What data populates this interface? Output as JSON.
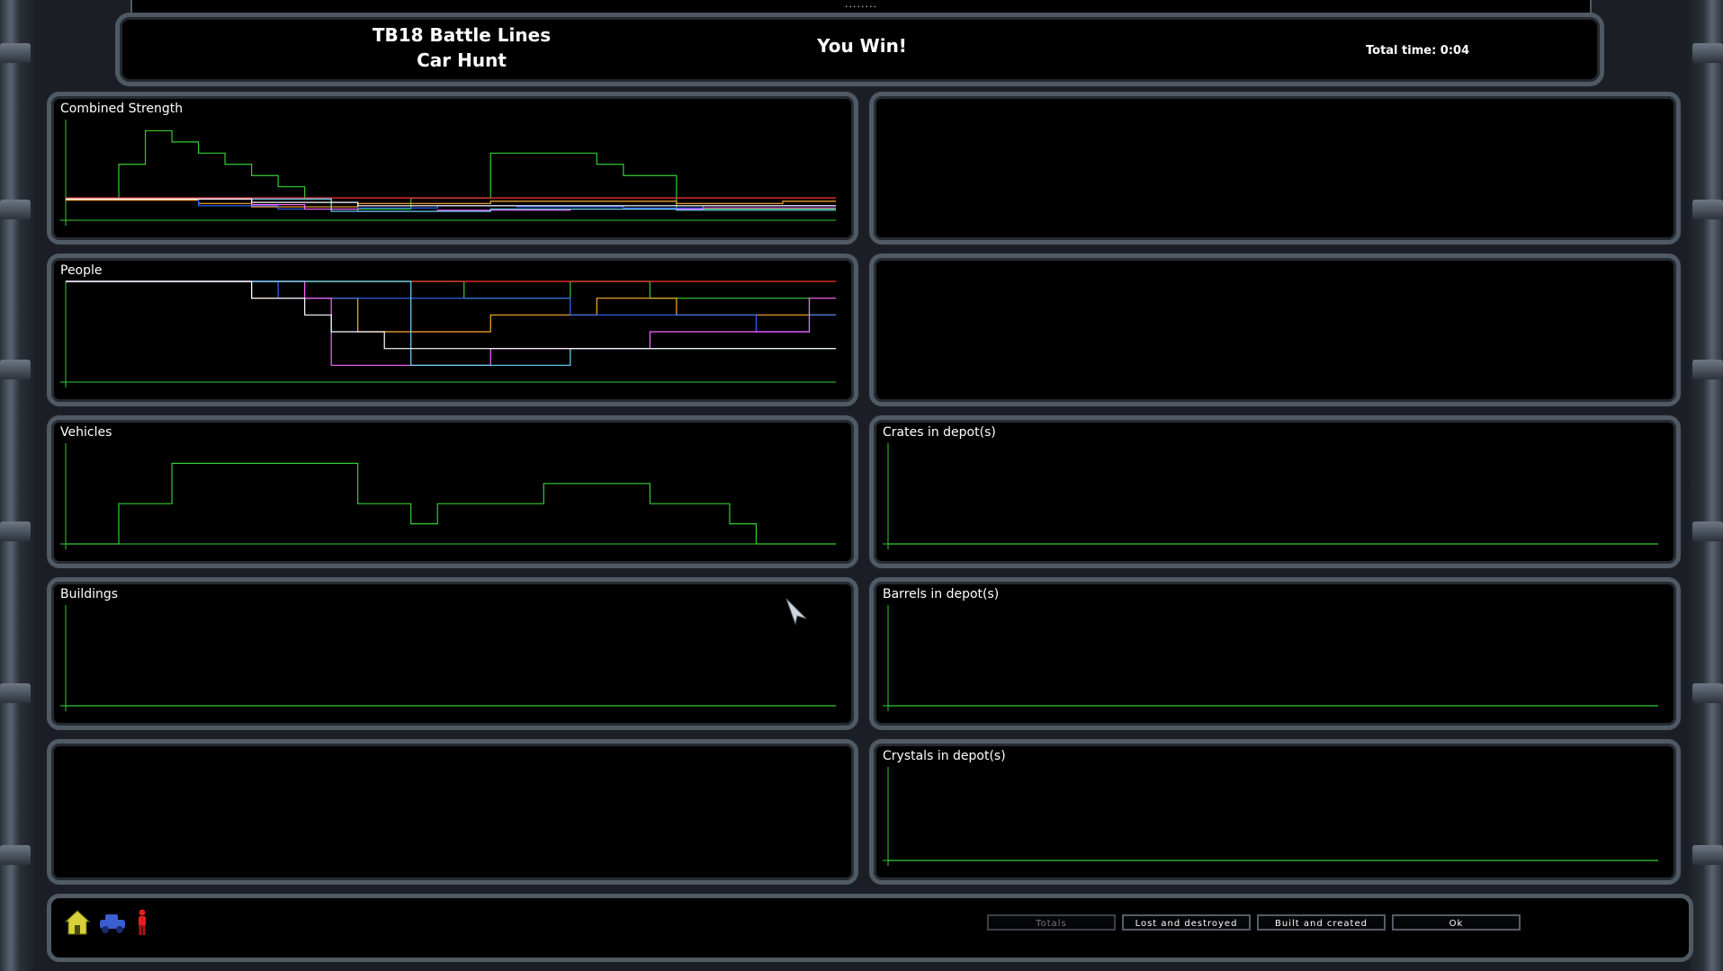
{
  "header": {
    "dots": "........",
    "title_line1": "TB18 Battle Lines",
    "title_line2": "Car Hunt",
    "result": "You Win!",
    "total_time": "Total time: 0:04"
  },
  "panels": {
    "combined_strength": "Combined Strength",
    "people": "People",
    "vehicles": "Vehicles",
    "buildings": "Buildings",
    "crates": "Crates in depot(s)",
    "barrels": "Barrels in depot(s)",
    "crystals": "Crystals in depot(s)"
  },
  "footer": {
    "buttons": [
      "Totals",
      "Lost and destroyed",
      "Built and created",
      "Ok"
    ],
    "icons": [
      "building-icon",
      "vehicle-icon",
      "person-icon"
    ]
  },
  "colors": {
    "green": "#33cc33",
    "red": "#ff3333",
    "orange": "#ffaa33",
    "blue": "#3366ff",
    "magenta": "#ff66ff",
    "cyan": "#66ddff",
    "white": "#ffffff",
    "panel_border": "#505a65"
  },
  "chart_data": [
    {
      "type": "line",
      "title": "Combined Strength",
      "x": [
        0,
        1,
        2,
        3,
        4,
        5,
        6,
        7,
        8,
        9,
        10,
        11,
        12,
        13,
        14,
        15,
        16,
        17,
        18,
        19,
        20,
        21,
        22,
        23,
        24,
        25,
        26,
        27,
        28,
        29
      ],
      "series": [
        {
          "color": "#33cc33",
          "values": [
            2,
            2,
            5,
            8,
            7,
            6,
            5,
            4,
            3,
            2,
            1,
            1,
            1,
            2,
            2,
            2,
            6,
            6,
            6,
            6,
            5,
            4,
            4,
            1,
            1,
            1,
            1,
            1,
            1,
            1
          ]
        },
        {
          "color": "#ff3333",
          "values": [
            2,
            2,
            2,
            2,
            2,
            2,
            2,
            2,
            2,
            2,
            2,
            2,
            2,
            2,
            2,
            2,
            2,
            2,
            2,
            2,
            2,
            2,
            2,
            2,
            2,
            2,
            2,
            2,
            2,
            2
          ]
        },
        {
          "color": "#ffaa33",
          "values": [
            1.8,
            1.8,
            1.8,
            1.8,
            1.8,
            1.5,
            1.5,
            1.2,
            1.2,
            1.2,
            1.2,
            1.5,
            1.5,
            1.5,
            1.5,
            1.5,
            1.7,
            1.7,
            1.7,
            1.7,
            1.7,
            1.7,
            1.7,
            1.5,
            1.5,
            1.5,
            1.5,
            1.7,
            1.7,
            1.7
          ]
        },
        {
          "color": "#3366ff",
          "values": [
            1.9,
            1.9,
            1.9,
            1.9,
            1.9,
            1.3,
            1.3,
            1.3,
            1,
            1,
            1,
            1.1,
            1.1,
            1.1,
            1.3,
            1.3,
            1.3,
            1.2,
            1.2,
            1.2,
            1.2,
            1.1,
            1.1,
            1.1,
            1.3,
            1.3,
            1.3,
            1.3,
            1.3,
            1.3
          ]
        },
        {
          "color": "#ff66ff",
          "values": [
            1.9,
            1.9,
            1.9,
            1.9,
            1.9,
            1.9,
            1.9,
            1.4,
            1.4,
            1,
            1,
            0.8,
            0.8,
            0.8,
            0.9,
            0.9,
            0.9,
            0.9,
            0.9,
            1,
            1,
            1,
            1,
            1,
            1.1,
            1.1,
            1.1,
            1.1,
            1.1,
            1.1
          ]
        },
        {
          "color": "#66ddff",
          "values": [
            1.9,
            1.9,
            1.9,
            1.9,
            1.9,
            1.9,
            1.9,
            1.9,
            1.9,
            1.9,
            0.8,
            0.8,
            0.8,
            0.8,
            0.8,
            0.8,
            1,
            1,
            1,
            1,
            1,
            1,
            1,
            0.9,
            0.9,
            0.9,
            0.9,
            0.9,
            0.9,
            0.9
          ]
        },
        {
          "color": "#ffffff",
          "values": [
            1.9,
            1.9,
            1.9,
            1.9,
            1.9,
            1.9,
            1.9,
            1.6,
            1.6,
            1.6,
            1.6,
            1.3,
            1.3,
            1.3,
            1.3,
            1.3,
            1.3,
            1.3,
            1.3,
            1.3,
            1.3,
            1.3,
            1.3,
            1.3,
            1.3,
            1.3,
            1.3,
            1.3,
            1.3,
            1.3
          ]
        }
      ],
      "ylim": [
        0,
        9
      ]
    },
    {
      "type": "line",
      "title": "People",
      "x": [
        0,
        1,
        2,
        3,
        4,
        5,
        6,
        7,
        8,
        9,
        10,
        11,
        12,
        13,
        14,
        15,
        16,
        17,
        18,
        19,
        20,
        21,
        22,
        23,
        24,
        25,
        26,
        27,
        28,
        29
      ],
      "series": [
        {
          "color": "#33cc33",
          "values": [
            6,
            6,
            6,
            6,
            6,
            6,
            6,
            6,
            6,
            6,
            6,
            6,
            6,
            6,
            6,
            5,
            5,
            5,
            5,
            6,
            6,
            6,
            5,
            5,
            5,
            5,
            5,
            5,
            4,
            4
          ]
        },
        {
          "color": "#ff3333",
          "values": [
            6,
            6,
            6,
            6,
            6,
            6,
            6,
            6,
            6,
            6,
            6,
            6,
            6,
            6,
            6,
            6,
            6,
            6,
            6,
            6,
            6,
            6,
            6,
            6,
            6,
            6,
            6,
            6,
            6,
            6
          ]
        },
        {
          "color": "#ffaa33",
          "values": [
            6,
            6,
            6,
            6,
            6,
            6,
            6,
            5,
            5,
            5,
            5,
            3,
            3,
            3,
            3,
            3,
            4,
            4,
            4,
            4,
            5,
            5,
            5,
            4,
            4,
            4,
            4,
            4,
            4,
            4
          ]
        },
        {
          "color": "#3366ff",
          "values": [
            6,
            6,
            6,
            6,
            6,
            6,
            6,
            6,
            5,
            5,
            5,
            5,
            5,
            5,
            5,
            5,
            5,
            5,
            5,
            4,
            4,
            4,
            4,
            4,
            4,
            4,
            3,
            3,
            4,
            4
          ]
        },
        {
          "color": "#ff66ff",
          "values": [
            6,
            6,
            6,
            6,
            6,
            6,
            6,
            6,
            6,
            5,
            1,
            1,
            1,
            1,
            1,
            1,
            2,
            2,
            2,
            2,
            2,
            2,
            3,
            3,
            3,
            3,
            3,
            3,
            5,
            5
          ]
        },
        {
          "color": "#66ddff",
          "values": [
            6,
            6,
            6,
            6,
            6,
            6,
            6,
            6,
            6,
            6,
            6,
            6,
            6,
            1,
            1,
            1,
            1,
            1,
            1,
            2,
            2,
            2,
            2,
            2,
            2,
            2,
            2,
            2,
            2,
            2
          ]
        },
        {
          "color": "#ffffff",
          "values": [
            6,
            6,
            6,
            6,
            6,
            6,
            6,
            5,
            5,
            4,
            3,
            3,
            2,
            2,
            2,
            2,
            2,
            2,
            2,
            2,
            2,
            2,
            2,
            2,
            2,
            2,
            2,
            2,
            2,
            2
          ]
        }
      ],
      "ylim": [
        0,
        6
      ]
    },
    {
      "type": "line",
      "title": "Vehicles",
      "x": [
        0,
        1,
        2,
        3,
        4,
        5,
        6,
        7,
        8,
        9,
        10,
        11,
        12,
        13,
        14,
        15,
        16,
        17,
        18,
        19,
        20,
        21,
        22,
        23,
        24,
        25,
        26,
        27,
        28,
        29
      ],
      "series": [
        {
          "color": "#33cc33",
          "values": [
            0,
            0,
            2,
            2,
            4,
            4,
            4,
            4,
            4,
            4,
            4,
            2,
            2,
            1,
            2,
            2,
            2,
            2,
            3,
            3,
            3,
            3,
            2,
            2,
            2,
            1,
            0,
            0,
            0,
            0
          ]
        }
      ],
      "ylim": [
        0,
        5
      ]
    },
    {
      "type": "line",
      "title": "Buildings",
      "series": [
        {
          "color": "#33cc33",
          "values": [
            0,
            0
          ]
        }
      ],
      "ylim": [
        0,
        1
      ]
    },
    {
      "type": "line",
      "title": "Crates in depot(s)",
      "series": [
        {
          "color": "#33cc33",
          "values": [
            0,
            0
          ]
        }
      ],
      "ylim": [
        0,
        1
      ]
    },
    {
      "type": "line",
      "title": "Barrels in depot(s)",
      "series": [
        {
          "color": "#33cc33",
          "values": [
            0,
            0
          ]
        }
      ],
      "ylim": [
        0,
        1
      ]
    },
    {
      "type": "line",
      "title": "Crystals in depot(s)",
      "series": [
        {
          "color": "#33cc33",
          "values": [
            0,
            0
          ]
        }
      ],
      "ylim": [
        0,
        1
      ]
    }
  ]
}
